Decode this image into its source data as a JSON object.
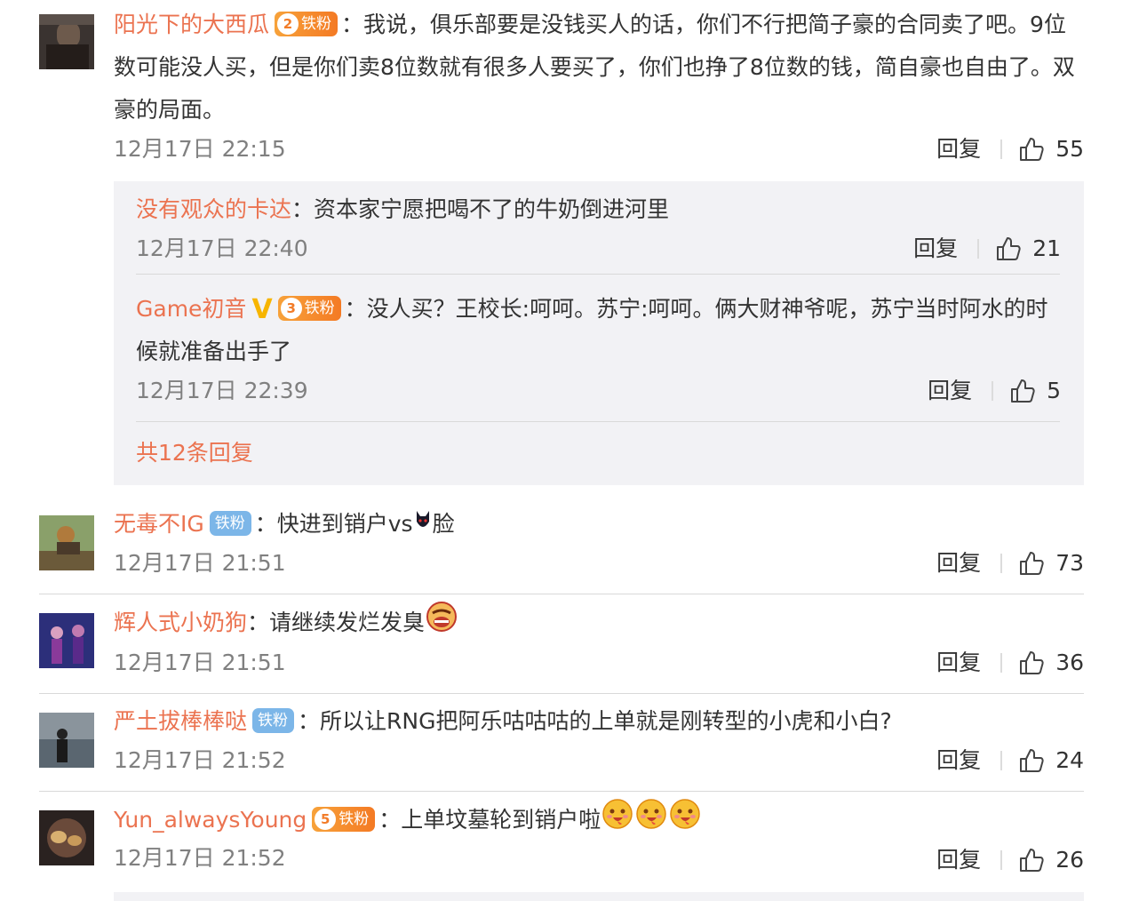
{
  "comments": [
    {
      "user": "阳光下的大西瓜",
      "badge_level": "2",
      "badge_text": "铁粉",
      "sep": "：",
      "text_l1": "我说，俱乐部要是没钱买人的话，你们不行把简子豪的合同卖了吧。9位",
      "text_l2": "数可能没人买，但是你们卖8位数就有很多人要买了，你们也挣了8位数的钱，简自豪也自由了。双",
      "text_l3": "豪的局面。",
      "time": "12月17日 22:15",
      "reply": "回复",
      "likes": "55"
    },
    {
      "user": "无毒不IG",
      "badge_text": "铁粉",
      "sep": "：",
      "text_a": "快进到销户vs",
      "text_b": "脸",
      "time": "12月17日 21:51",
      "reply": "回复",
      "likes": "73"
    },
    {
      "user": "辉人式小奶狗",
      "sep": "：",
      "text": "请继续发烂发臭",
      "time": "12月17日 21:51",
      "reply": "回复",
      "likes": "36"
    },
    {
      "user": "严土拔棒棒哒",
      "badge_text": "铁粉",
      "sep": "：",
      "text": "所以让RNG把阿乐咕咕咕的上单就是刚转型的小虎和小白?",
      "time": "12月17日 21:52",
      "reply": "回复",
      "likes": "24"
    },
    {
      "user": "Yun_alwaysYoung",
      "badge_level": "5",
      "badge_text": "铁粉",
      "sep": "：",
      "text": "上单坟墓轮到销户啦",
      "time": "12月17日 21:52",
      "reply": "回复",
      "likes": "26"
    }
  ],
  "replies": [
    {
      "user": "没有观众的卡达",
      "sep": "：",
      "text": "资本家宁愿把喝不了的牛奶倒进河里",
      "time": "12月17日 22:40",
      "reply": "回复",
      "likes": "21"
    },
    {
      "user": "Game初音",
      "verified": "V",
      "badge_level": "3",
      "badge_text": "铁粉",
      "sep": "：",
      "text_l1": "没人买？王校长:呵呵。苏宁:呵呵。俩大财神爷呢，苏宁当时阿水的时",
      "text_l2": "候就准备出手了",
      "time": "12月17日 22:39",
      "reply": "回复",
      "likes": "5"
    }
  ],
  "more_replies": "共12条回复",
  "icons": {
    "like": "thumbs-up-icon",
    "laugh_emoji": "laugh-emoji",
    "devil_emoji": "devil-emoji",
    "vomit_emoji": "vomit-emoji"
  },
  "colors": {
    "username": "#eb7350",
    "time": "#808080",
    "fan_badge": "#f47a24",
    "iron_badge": "#7cb6e8",
    "reply_box": "#f2f2f5"
  }
}
